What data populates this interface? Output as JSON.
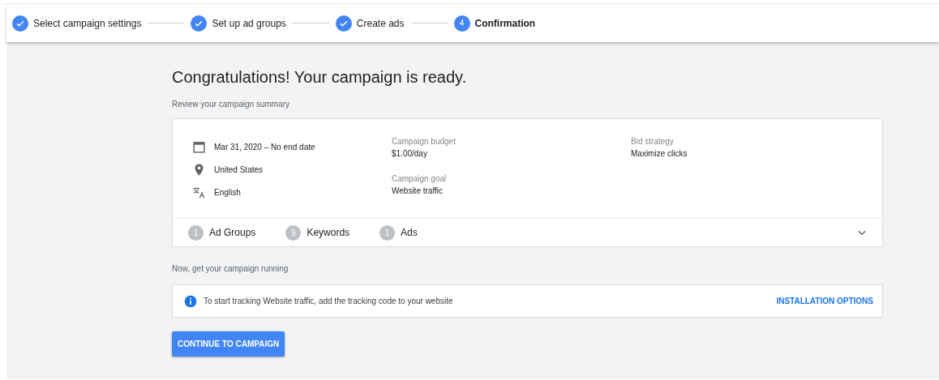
{
  "steps": [
    {
      "label": "Select campaign settings",
      "completed": true,
      "selected": false
    },
    {
      "label": "Set up ad groups",
      "completed": true,
      "selected": false
    },
    {
      "label": "Create ads",
      "completed": true,
      "selected": false
    },
    {
      "label": "Confirmation",
      "completed": false,
      "selected": true,
      "number": "4"
    }
  ],
  "heading": "Congratulations! Your campaign is ready.",
  "summary_label": "Review your campaign summary",
  "summary": {
    "details": [
      {
        "kind": "calendar",
        "text": "Mar 31, 2020 – No end date"
      },
      {
        "kind": "location",
        "text": "United States"
      },
      {
        "kind": "language",
        "text": "English"
      }
    ],
    "columns": [
      [
        {
          "label": "Campaign budget",
          "value": "$1.00/day"
        },
        {
          "label": "Campaign goal",
          "value": "Website traffic"
        }
      ],
      [
        {
          "label": "Bid strategy",
          "value": "Maximize clicks"
        }
      ]
    ],
    "counts": [
      {
        "count": "1",
        "label": "Ad Groups"
      },
      {
        "count": "9",
        "label": "Keywords"
      },
      {
        "count": "1",
        "label": "Ads"
      }
    ],
    "expanded": false
  },
  "running_label": "Now, get your campaign running",
  "notice": {
    "text": "To start tracking Website traffic, add the tracking code to your website",
    "action": "INSTALLATION OPTIONS"
  },
  "primary_button": "CONTINUE TO CAMPAIGN"
}
